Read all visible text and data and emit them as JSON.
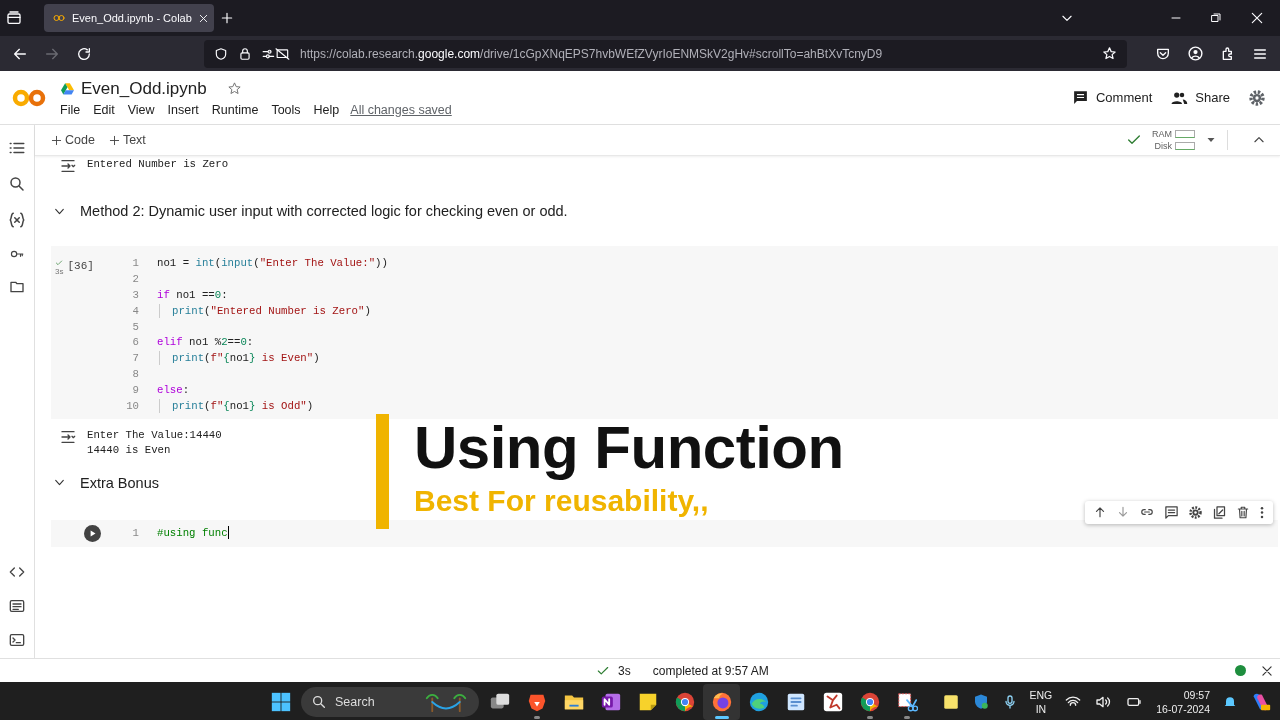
{
  "browser": {
    "tab": {
      "title": "Even_Odd.ipynb - Colab",
      "selected": true
    },
    "forward_disabled": true,
    "url": {
      "prefix": "https://colab.research.",
      "domain": "google.com",
      "path": "/drive/1cGpXNqEPS7hvbWEfZVyrIoENMSkV2gHv#scrollTo=ahBtXvTcnyD9"
    }
  },
  "notebook": {
    "title": "Even_Odd.ipynb",
    "starred": false,
    "menu": [
      "File",
      "Edit",
      "View",
      "Insert",
      "Runtime",
      "Tools",
      "Help"
    ],
    "save_status": "All changes saved",
    "actions": [
      {
        "kind": "comment",
        "label": "Comment"
      },
      {
        "kind": "share",
        "label": "Share"
      }
    ]
  },
  "toolbar": {
    "add_buttons": [
      "Code",
      "Text"
    ],
    "connected": true,
    "ram_label": "RAM",
    "disk_label": "Disk"
  },
  "cells": [
    {
      "kind": "output",
      "lines": [
        "Entered Number is Zero"
      ]
    },
    {
      "kind": "heading",
      "text": "Method 2: Dynamic user input with corrected logic for checking even or odd.",
      "expanded": true
    },
    {
      "kind": "code",
      "exec_count": "[36]",
      "run_time": "3s",
      "focused": false,
      "lines": [
        {
          "number": "1",
          "indented": false,
          "tokens": [
            {
              "kind": "plain",
              "s": "no1 = "
            },
            {
              "kind": "fn",
              "s": "int"
            },
            {
              "kind": "plain",
              "s": "("
            },
            {
              "kind": "fn",
              "s": "input"
            },
            {
              "kind": "plain",
              "s": "("
            },
            {
              "kind": "str",
              "s": "\"Enter The Value:\""
            },
            {
              "kind": "plain",
              "s": "))"
            }
          ]
        },
        {
          "number": "2",
          "indented": false
        },
        {
          "number": "3",
          "indented": false,
          "tokens": [
            {
              "kind": "kw",
              "s": "if"
            },
            {
              "kind": "plain",
              "s": " no1 =="
            },
            {
              "kind": "num",
              "s": "0"
            },
            {
              "kind": "plain",
              "s": ":"
            }
          ]
        },
        {
          "number": "4",
          "indented": true,
          "tokens": [
            {
              "kind": "fn",
              "s": "print"
            },
            {
              "kind": "plain",
              "s": "("
            },
            {
              "kind": "str",
              "s": "\"Entered Number is Zero\""
            },
            {
              "kind": "plain",
              "s": ")"
            }
          ]
        },
        {
          "number": "5",
          "indented": false
        },
        {
          "number": "6",
          "indented": false,
          "tokens": [
            {
              "kind": "kw",
              "s": "elif"
            },
            {
              "kind": "plain",
              "s": " no1 %"
            },
            {
              "kind": "num",
              "s": "2"
            },
            {
              "kind": "plain",
              "s": "=="
            },
            {
              "kind": "num",
              "s": "0"
            },
            {
              "kind": "plain",
              "s": ":"
            }
          ]
        },
        {
          "number": "7",
          "indented": true,
          "tokens": [
            {
              "kind": "fn",
              "s": "print"
            },
            {
              "kind": "plain",
              "s": "("
            },
            {
              "kind": "str",
              "s": "f\""
            },
            {
              "kind": "brace",
              "s": "{"
            },
            {
              "kind": "plain",
              "s": "no1"
            },
            {
              "kind": "brace",
              "s": "}"
            },
            {
              "kind": "str",
              "s": " is Even\""
            },
            {
              "kind": "plain",
              "s": ")"
            }
          ]
        },
        {
          "number": "8",
          "indented": false
        },
        {
          "number": "9",
          "indented": false,
          "tokens": [
            {
              "kind": "kw",
              "s": "else"
            },
            {
              "kind": "plain",
              "s": ":"
            }
          ]
        },
        {
          "number": "10",
          "indented": true,
          "tokens": [
            {
              "kind": "fn",
              "s": "print"
            },
            {
              "kind": "plain",
              "s": "("
            },
            {
              "kind": "str",
              "s": "f\""
            },
            {
              "kind": "brace",
              "s": "{"
            },
            {
              "kind": "plain",
              "s": "no1"
            },
            {
              "kind": "brace",
              "s": "}"
            },
            {
              "kind": "str",
              "s": " is Odd\""
            },
            {
              "kind": "plain",
              "s": ")"
            }
          ]
        }
      ]
    },
    {
      "kind": "output",
      "lines": [
        "Enter The Value:14440",
        "14440 is Even"
      ]
    },
    {
      "kind": "heading",
      "text": "Extra Bonus",
      "expanded": true
    },
    {
      "kind": "code",
      "focused": true,
      "lines": [
        {
          "number": "1",
          "indented": false,
          "cursor": true,
          "tokens": [
            {
              "kind": "comment",
              "s": "#using func"
            }
          ]
        }
      ]
    }
  ],
  "overlay": {
    "title": "Using Function",
    "subtitle": "Best For reusability,,"
  },
  "status_bar": {
    "succeeded": true,
    "duration": "3s",
    "message": "completed at 9:57 AM",
    "connected": true
  },
  "taskbar": {
    "search_placeholder": "Search",
    "apps": [
      {
        "kind": "windows",
        "running": false,
        "active": false
      },
      {
        "kind": "task-view",
        "running": false,
        "active": false
      },
      {
        "kind": "lion",
        "running": true,
        "active": false
      },
      {
        "kind": "folder",
        "running": false,
        "active": false
      },
      {
        "kind": "notebook",
        "running": false,
        "active": false
      },
      {
        "kind": "sticky",
        "running": false,
        "active": false
      },
      {
        "kind": "round-browser",
        "running": false,
        "active": false
      },
      {
        "kind": "fox",
        "running": true,
        "active": true
      },
      {
        "kind": "wave",
        "running": false,
        "active": false
      },
      {
        "kind": "document",
        "running": false,
        "active": false
      },
      {
        "kind": "shapes",
        "running": false,
        "active": false
      },
      {
        "kind": "round-browser",
        "running": true,
        "active": false
      },
      {
        "kind": "snip",
        "running": true,
        "active": false
      }
    ],
    "language": "ENG",
    "region": "IN",
    "time": "09:57",
    "date": "16-07-2024"
  }
}
